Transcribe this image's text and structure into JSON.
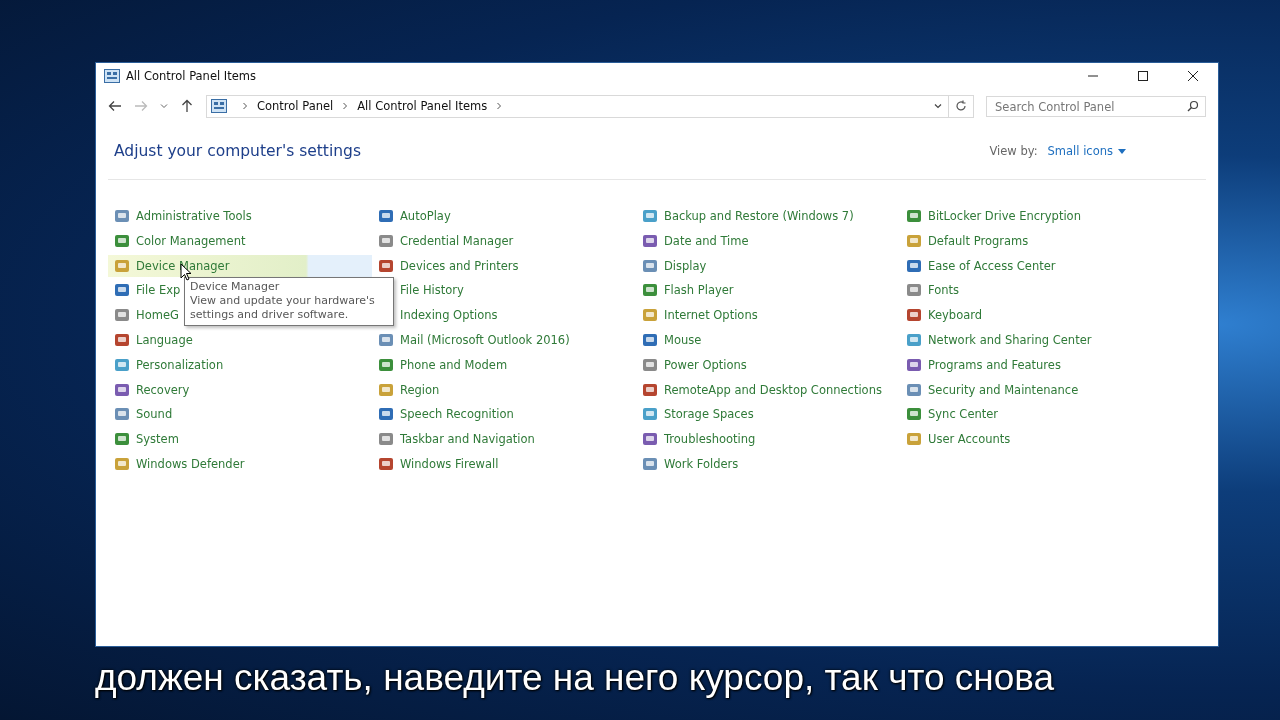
{
  "window": {
    "title": "All Control Panel Items"
  },
  "address_bar": {
    "breadcrumbs": [
      "Control Panel",
      "All Control Panel Items"
    ]
  },
  "search": {
    "placeholder": "Search Control Panel"
  },
  "heading": "Adjust your computer's settings",
  "view_by": {
    "label": "View by:",
    "value": "Small icons"
  },
  "columns": [
    [
      {
        "label": "Administrative Tools",
        "highlighted": false
      },
      {
        "label": "Color Management",
        "highlighted": false
      },
      {
        "label": "Device Manager",
        "highlighted": true,
        "tooltip": {
          "title": "Device Manager",
          "text": "View and update your hardware's settings and driver software."
        }
      },
      {
        "label": "File Exp",
        "highlighted": false
      },
      {
        "label": "HomeG",
        "highlighted": false
      },
      {
        "label": "Language",
        "highlighted": false
      },
      {
        "label": "Personalization",
        "highlighted": false
      },
      {
        "label": "Recovery",
        "highlighted": false
      },
      {
        "label": "Sound",
        "highlighted": false
      },
      {
        "label": "System",
        "highlighted": false
      },
      {
        "label": "Windows Defender",
        "highlighted": false
      }
    ],
    [
      {
        "label": "AutoPlay",
        "highlighted": false
      },
      {
        "label": "Credential Manager",
        "highlighted": false
      },
      {
        "label": "Devices and Printers",
        "highlighted": false
      },
      {
        "label": "File History",
        "highlighted": false
      },
      {
        "label": "Indexing Options",
        "highlighted": false
      },
      {
        "label": "Mail (Microsoft Outlook 2016)",
        "highlighted": false
      },
      {
        "label": "Phone and Modem",
        "highlighted": false
      },
      {
        "label": "Region",
        "highlighted": false
      },
      {
        "label": "Speech Recognition",
        "highlighted": false
      },
      {
        "label": "Taskbar and Navigation",
        "highlighted": false
      },
      {
        "label": "Windows Firewall",
        "highlighted": false
      }
    ],
    [
      {
        "label": "Backup and Restore (Windows 7)",
        "highlighted": false
      },
      {
        "label": "Date and Time",
        "highlighted": false
      },
      {
        "label": "Display",
        "highlighted": false
      },
      {
        "label": "Flash Player",
        "highlighted": false
      },
      {
        "label": "Internet Options",
        "highlighted": false
      },
      {
        "label": "Mouse",
        "highlighted": false
      },
      {
        "label": "Power Options",
        "highlighted": false
      },
      {
        "label": "RemoteApp and Desktop Connections",
        "highlighted": false
      },
      {
        "label": "Storage Spaces",
        "highlighted": false
      },
      {
        "label": "Troubleshooting",
        "highlighted": false
      },
      {
        "label": "Work Folders",
        "highlighted": false
      }
    ],
    [
      {
        "label": "BitLocker Drive Encryption",
        "highlighted": false
      },
      {
        "label": "Default Programs",
        "highlighted": false
      },
      {
        "label": "Ease of Access Center",
        "highlighted": false
      },
      {
        "label": "Fonts",
        "highlighted": false
      },
      {
        "label": "Keyboard",
        "highlighted": false
      },
      {
        "label": "Network and Sharing Center",
        "highlighted": false
      },
      {
        "label": "Programs and Features",
        "highlighted": false
      },
      {
        "label": "Security and Maintenance",
        "highlighted": false
      },
      {
        "label": "Sync Center",
        "highlighted": false
      },
      {
        "label": "User Accounts",
        "highlighted": false
      }
    ]
  ],
  "subtitle": "должен сказать, наведите на него курсор, так что снова"
}
